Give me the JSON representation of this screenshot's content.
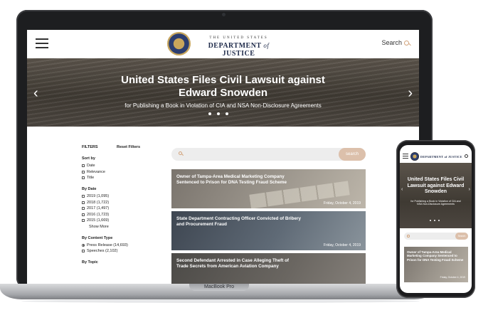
{
  "laptop": {
    "label": "MacBook Pro"
  },
  "header": {
    "logo_top": "THE UNITED STATES",
    "logo_main_a": "DEPARTMENT",
    "logo_main_of": "of",
    "logo_main_b": "JUSTICE",
    "search_label": "Search"
  },
  "hero": {
    "title": "United States Files Civil Lawsuit against Edward Snowden",
    "subtitle": "for Publishing a Book in Violation of CIA and NSA Non-Disclosure Agreements",
    "prev_arrow": "‹",
    "next_arrow": "›"
  },
  "filters": {
    "title": "FILTERS",
    "reset": "Reset Filters",
    "sort_by": {
      "title": "Sort by",
      "options": [
        "Date",
        "Relevance",
        "Title"
      ]
    },
    "by_date": {
      "title": "By Date",
      "options": [
        "2019 (1,095)",
        "2018 (1,722)",
        "2017 (1,497)",
        "2016 (1,723)",
        "2015 (1,669)"
      ],
      "show_more": "Show More"
    },
    "by_content_type": {
      "title": "By Content Type",
      "options": [
        "Press Release (14,693)",
        "Speeches (2,102)"
      ]
    },
    "by_topic": {
      "title": "By Topic"
    }
  },
  "search": {
    "placeholder": "",
    "button": "search"
  },
  "results": [
    {
      "title": "Owner of Tampa-Area Medical Marketing Company Sentenced to Prison for DNA Testing Fraud Scheme",
      "date": "Friday, October 4, 2019"
    },
    {
      "title": "State Department Contracting Officer Convicted of Bribery and Procurement Fraud",
      "date": "Friday, October 4, 2019"
    },
    {
      "title": "Second Defendant Arrested in Case Alleging Theft of Trade Secrets from American Aviation Company",
      "date": ""
    }
  ],
  "phone": {
    "logo": "DEPARTMENT of JUSTICE",
    "hero_title": "United States Files Civil Lawsuit against Edward Snowden",
    "hero_subtitle": "for Publishing a Book in Violation of CIA and NSA Non-Disclosure Agreements",
    "search_button": "Search",
    "result_title": "Owner of Tampa-Area Medical Marketing Company Sentenced to Prison for DNA Testing Fraud Scheme",
    "result_date": "Friday, October 4, 2019"
  }
}
